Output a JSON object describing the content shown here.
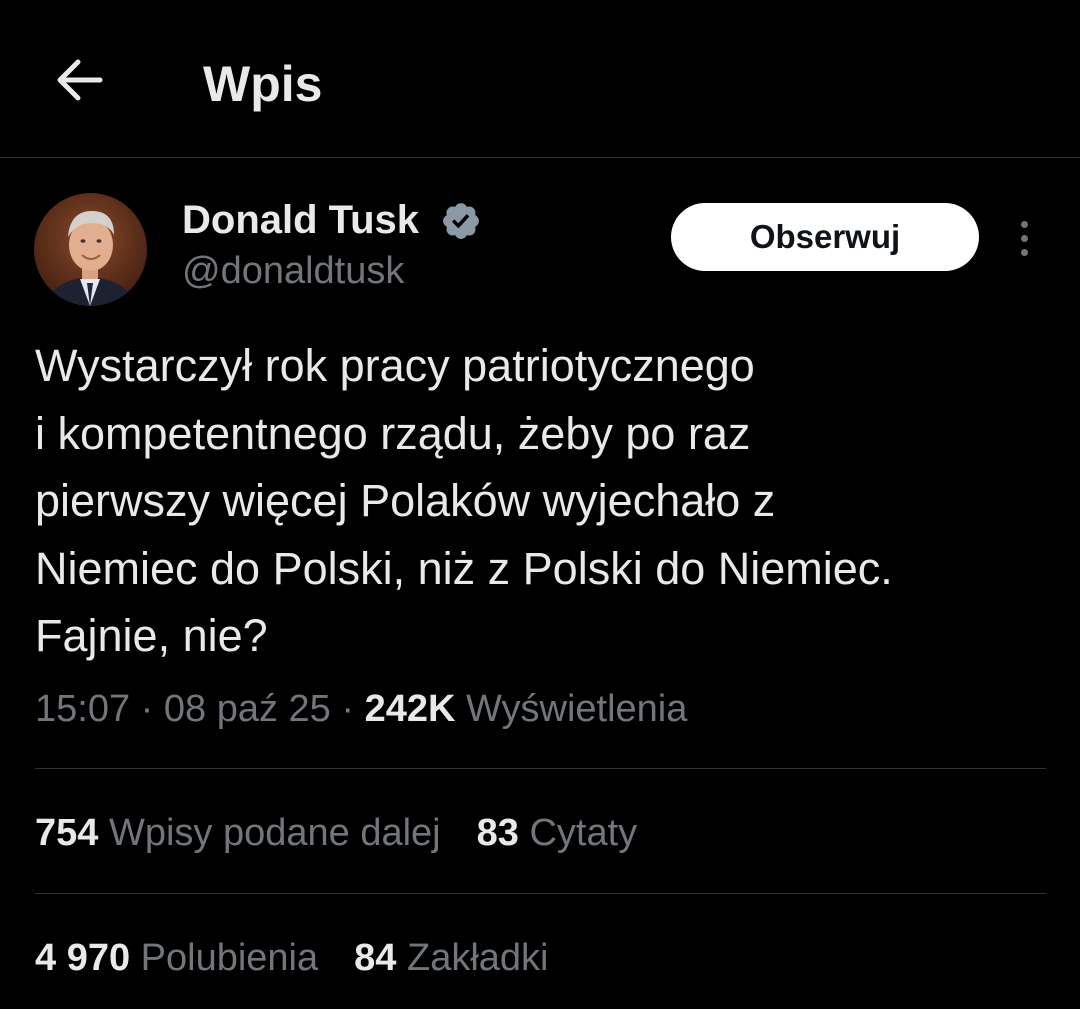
{
  "header": {
    "title": "Wpis",
    "back_icon": "arrow-left-icon"
  },
  "author": {
    "name": "Donald Tusk",
    "handle": "@donaldtusk",
    "verified_icon": "verified-badge-icon",
    "verified_color": "#8b98a5"
  },
  "follow_button": {
    "label": "Obserwuj"
  },
  "more_icon": "more-vertical-icon",
  "tweet": {
    "text": "Wystarczył rok pracy patriotycznego\ni kompetentnego rządu, żeby po raz\npierwszy więcej Polaków wyjechało z\nNiemiec do Polski, niż z Polski do Niemiec.\nFajnie, nie?",
    "time": "15:07",
    "date": "08 paź 25",
    "separator": "·",
    "views_count": "242K",
    "views_label": "Wyświetlenia"
  },
  "stats": {
    "reposts_count": "754",
    "reposts_label": "Wpisy podane dalej",
    "quotes_count": "83",
    "quotes_label": "Cytaty",
    "likes_count": "4 970",
    "likes_label": "Polubienia",
    "bookmarks_count": "84",
    "bookmarks_label": "Zakładki"
  },
  "colors": {
    "background": "#000000",
    "text_primary": "#e7e9ea",
    "text_secondary": "#71767b",
    "divider": "#2f3336",
    "follow_bg": "#ffffff"
  }
}
